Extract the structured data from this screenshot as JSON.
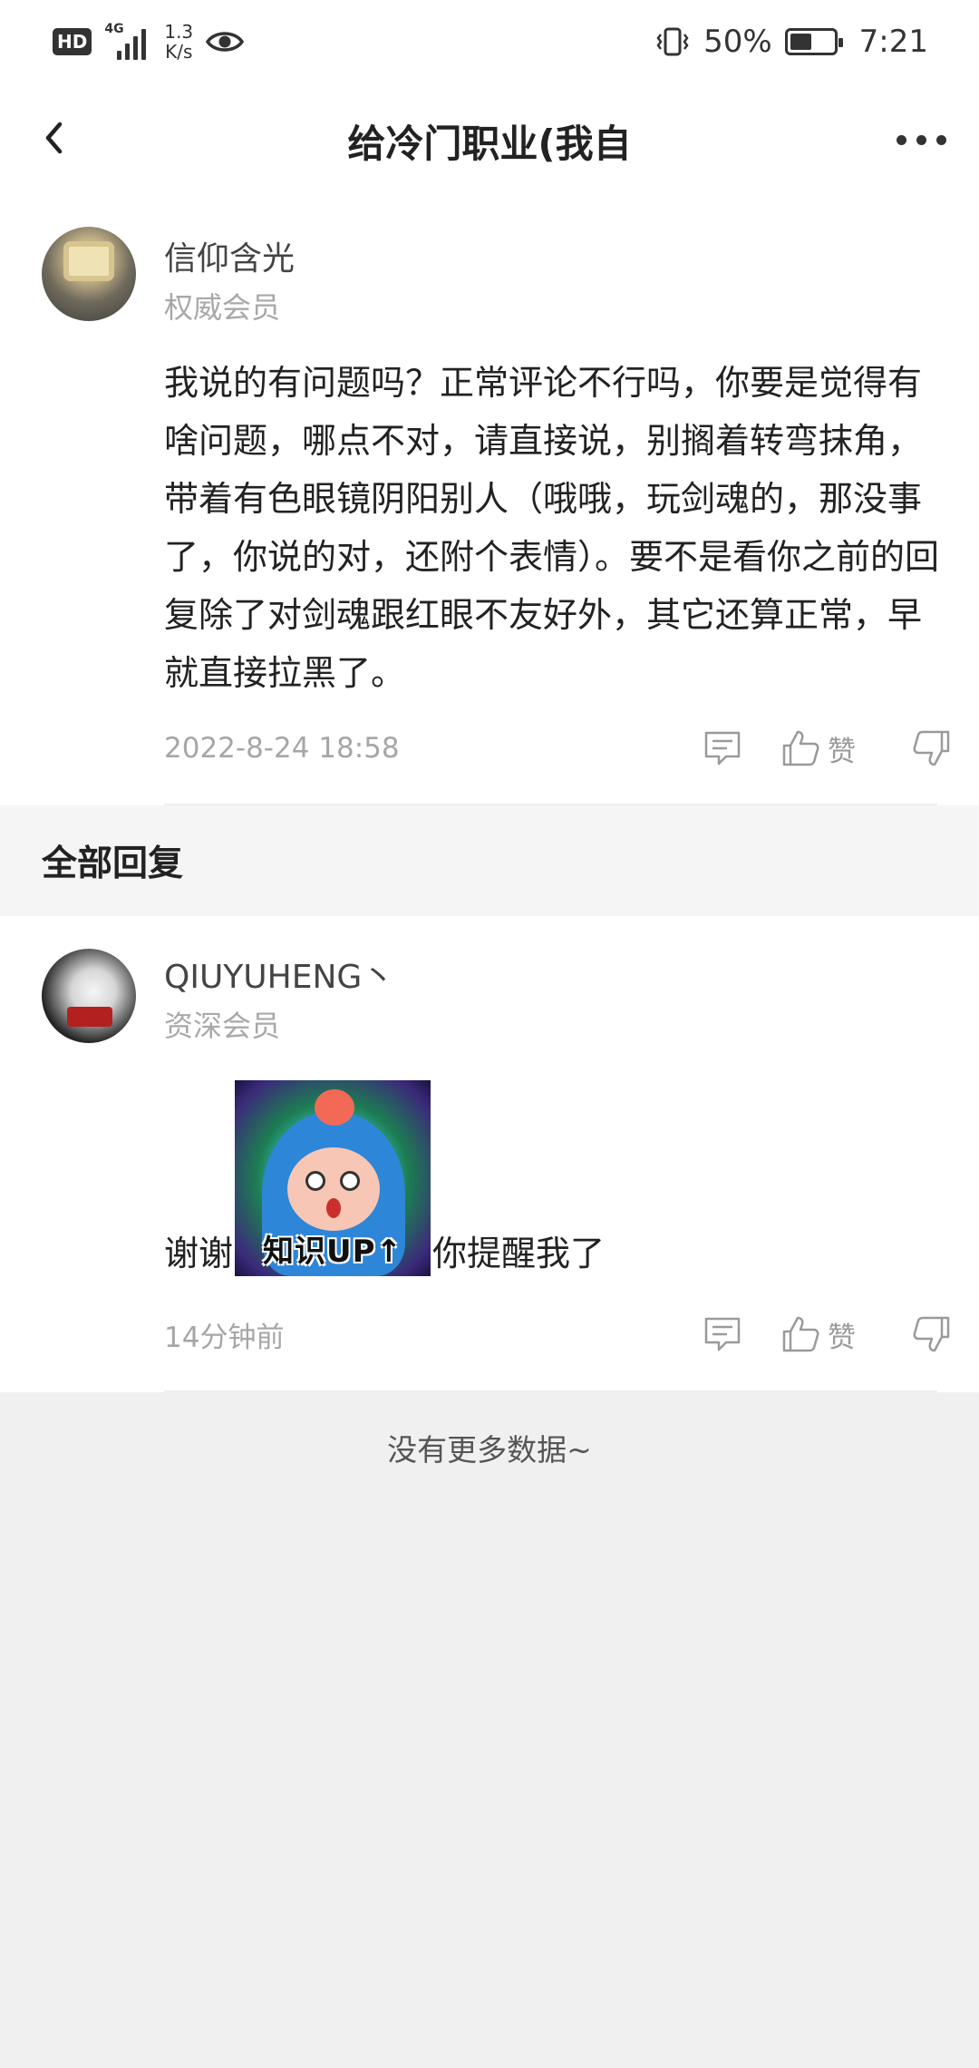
{
  "status_bar": {
    "hd": "HD",
    "network_type": "4G",
    "net_speed_value": "1.3",
    "net_speed_unit": "K/s",
    "battery_percent": "50%",
    "battery_level": 0.5,
    "time": "7:21"
  },
  "nav": {
    "title": "给冷门职业(我自"
  },
  "main_comment": {
    "username": "信仰含光",
    "member_level": "权威会员",
    "text": "我说的有问题吗？正常评论不行吗，你要是觉得有啥问题，哪点不对，请直接说，别搁着转弯抹角，带着有色眼镜阴阳别人（哦哦，玩剑魂的，那没事了，你说的对，还附个表情）。要不是看你之前的回复除了对剑魂跟红眼不友好外，其它还算正常，早就直接拉黑了。",
    "timestamp": "2022-8-24 18:58",
    "like_label": "赞"
  },
  "section": {
    "title": "全部回复"
  },
  "reply_comment": {
    "username": "QIUYUHENG丶",
    "member_level": "资深会员",
    "text_before": "谢谢",
    "sticker_caption": "知识UP↑",
    "text_after": "你提醒我了",
    "timestamp": "14分钟前",
    "like_label": "赞"
  },
  "footer": {
    "no_more_data": "没有更多数据~"
  },
  "colors": {
    "background": "#f0f0f0",
    "card": "#ffffff",
    "primary_text": "#222222",
    "secondary_text": "#a6a6a6"
  }
}
